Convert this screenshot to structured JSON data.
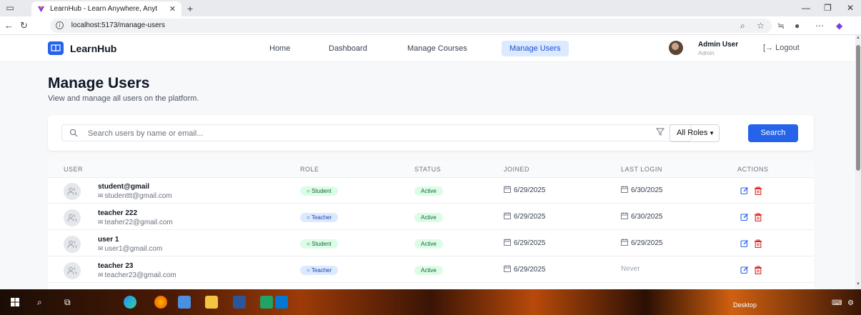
{
  "browser": {
    "tab_title": "LearnHub - Learn Anywhere, Anyt",
    "url": "localhost:5173/manage-users"
  },
  "app": {
    "brand": "LearnHub",
    "nav": [
      "Home",
      "Dashboard",
      "Manage Courses",
      "Manage Users"
    ],
    "active_nav": "Manage Users",
    "user_name": "Admin User",
    "user_role": "Admin",
    "logout_label": "Logout"
  },
  "page": {
    "title": "Manage Users",
    "subtitle": "View and manage all users on the platform."
  },
  "filters": {
    "search_placeholder": "Search users by name or email...",
    "role_value": "All Roles",
    "search_button": "Search"
  },
  "table": {
    "headers": [
      "USER",
      "ROLE",
      "STATUS",
      "JOINED",
      "LAST LOGIN",
      "ACTIONS"
    ],
    "rows": [
      {
        "name": "student@gmail",
        "email": "studenttt@gmail.com",
        "role": "Student",
        "status": "Active",
        "joined": "6/29/2025",
        "last_login": "6/30/2025"
      },
      {
        "name": "teacher 222",
        "email": "teaher22@gmail.com",
        "role": "Teacher",
        "status": "Active",
        "joined": "6/29/2025",
        "last_login": "6/30/2025"
      },
      {
        "name": "user 1",
        "email": "user1@gmail.com",
        "role": "Student",
        "status": "Active",
        "joined": "6/29/2025",
        "last_login": "6/29/2025"
      },
      {
        "name": "teacher 23",
        "email": "teacher23@gmail.com",
        "role": "Teacher",
        "status": "Active",
        "joined": "6/29/2025",
        "last_login": "Never"
      }
    ]
  },
  "taskbar": {
    "desktop_label": "Desktop"
  },
  "colors": {
    "primary": "#2563eb",
    "student_badge": "#dcfce7",
    "teacher_badge": "#dbeafe",
    "delete": "#dc2626"
  }
}
